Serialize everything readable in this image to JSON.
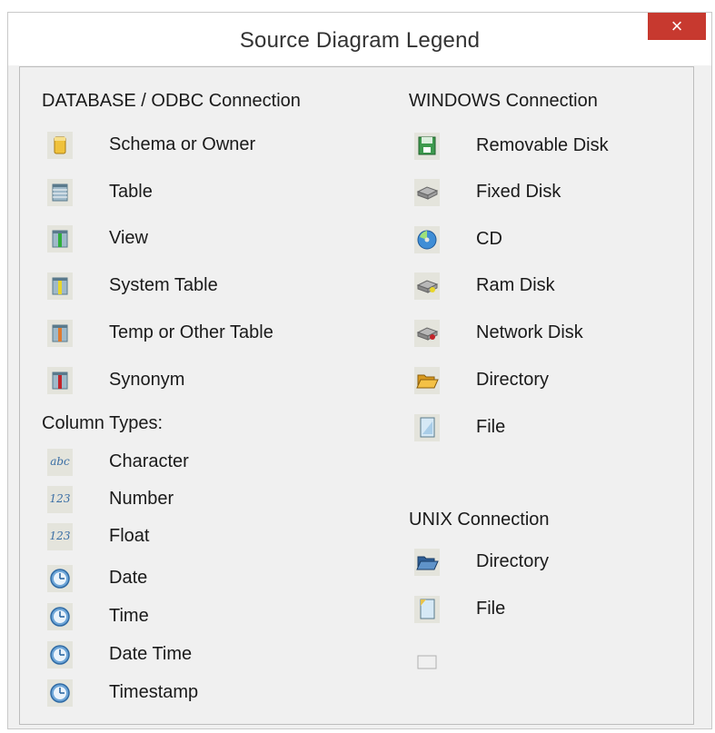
{
  "window": {
    "title": "Source Diagram Legend",
    "close_glyph": "×"
  },
  "left": {
    "db_heading": "DATABASE / ODBC  Connection",
    "db_items": [
      {
        "label": "Schema or Owner",
        "icon": "schema-icon"
      },
      {
        "label": "Table",
        "icon": "table-icon"
      },
      {
        "label": "View",
        "icon": "view-icon"
      },
      {
        "label": "System Table",
        "icon": "system-table-icon"
      },
      {
        "label": "Temp or Other Table",
        "icon": "temp-table-icon"
      },
      {
        "label": "Synonym",
        "icon": "synonym-icon"
      }
    ],
    "col_heading": "Column Types:",
    "col_items": [
      {
        "label": "Character",
        "icon": "character-icon",
        "glyph": "abc"
      },
      {
        "label": "Number",
        "icon": "number-icon",
        "glyph": "123"
      },
      {
        "label": "Float",
        "icon": "float-icon",
        "glyph": "123"
      },
      {
        "label": "Date",
        "icon": "clock-icon"
      },
      {
        "label": "Time",
        "icon": "clock-icon"
      },
      {
        "label": "Date Time",
        "icon": "clock-icon"
      },
      {
        "label": "Timestamp",
        "icon": "clock-icon"
      }
    ]
  },
  "right": {
    "win_heading": "WINDOWS Connection",
    "win_items": [
      {
        "label": "Removable Disk",
        "icon": "removable-disk-icon"
      },
      {
        "label": "Fixed Disk",
        "icon": "fixed-disk-icon"
      },
      {
        "label": "CD",
        "icon": "cd-icon"
      },
      {
        "label": "Ram Disk",
        "icon": "ram-disk-icon"
      },
      {
        "label": "Network Disk",
        "icon": "network-disk-icon"
      },
      {
        "label": "Directory",
        "icon": "folder-icon"
      },
      {
        "label": "File",
        "icon": "file-icon"
      }
    ],
    "unix_heading": "UNIX Connection",
    "unix_items": [
      {
        "label": "Directory",
        "icon": "folder-open-icon"
      },
      {
        "label": "File",
        "icon": "file-icon"
      }
    ]
  },
  "colors": {
    "close_bg": "#c7392f",
    "view_stripe": "#2fae3b",
    "system_stripe": "#e8d62a",
    "temp_stripe": "#e07a2e",
    "synonym_stripe": "#c2242a",
    "folder": "#e8a526",
    "unix_folder": "#3a6ea5"
  }
}
